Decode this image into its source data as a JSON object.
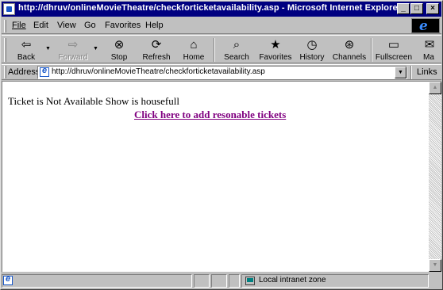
{
  "window": {
    "title": "http://dhruv/onlineMovieTheatre/checkforticketavailability.asp - Microsoft Internet Explorer",
    "minimize_glyph": "_",
    "maximize_glyph": "□",
    "close_glyph": "×"
  },
  "menu": {
    "items": [
      {
        "key": "F",
        "rest": "ile"
      },
      {
        "key": "E",
        "rest": "dit"
      },
      {
        "key": "V",
        "rest": "iew"
      },
      {
        "key": "G",
        "rest": "o"
      },
      {
        "key": "",
        "pre": "F",
        "key2": "a",
        "rest": "vorites"
      },
      {
        "key": "H",
        "rest": "elp"
      }
    ],
    "labels": [
      "File",
      "Edit",
      "View",
      "Go",
      "Favorites",
      "Help"
    ],
    "logo_glyph": "e"
  },
  "toolbar": {
    "back": {
      "label": "Back",
      "icon": "back-arrow-icon",
      "glyph": "⇦"
    },
    "forward": {
      "label": "Forward",
      "icon": "forward-arrow-icon",
      "glyph": "⇨"
    },
    "stop": {
      "label": "Stop",
      "icon": "stop-icon",
      "glyph": "⊗"
    },
    "refresh": {
      "label": "Refresh",
      "icon": "refresh-icon",
      "glyph": "⟳"
    },
    "home": {
      "label": "Home",
      "icon": "home-icon",
      "glyph": "⌂"
    },
    "search": {
      "label": "Search",
      "icon": "search-icon",
      "glyph": "⌕"
    },
    "favorites": {
      "label": "Favorites",
      "icon": "favorites-icon",
      "glyph": "★"
    },
    "history": {
      "label": "History",
      "icon": "history-icon",
      "glyph": "◷"
    },
    "channels": {
      "label": "Channels",
      "icon": "channels-icon",
      "glyph": "⊛"
    },
    "fullscreen": {
      "label": "Fullscreen",
      "icon": "fullscreen-icon",
      "glyph": "▭"
    },
    "mail": {
      "label": "Ma",
      "icon": "mail-icon",
      "glyph": "✉"
    },
    "dropdown_glyph": "▼"
  },
  "address": {
    "label": "Address",
    "url": "http://dhruv/onlineMovieTheatre/checkforticketavailability.asp",
    "dropdown_glyph": "▼",
    "links_label": "Links"
  },
  "page": {
    "message": "Ticket is Not Available Show is housefull",
    "link_text": "Click here to add resonable tickets",
    "link_color": "#800080"
  },
  "scrollbar": {
    "up_glyph": "▲",
    "down_glyph": "▼"
  },
  "status": {
    "zone": "Local intranet zone"
  },
  "colors": {
    "titlebar": "#000080",
    "chrome": "#c0c0c0",
    "content_bg": "#ffffff"
  }
}
